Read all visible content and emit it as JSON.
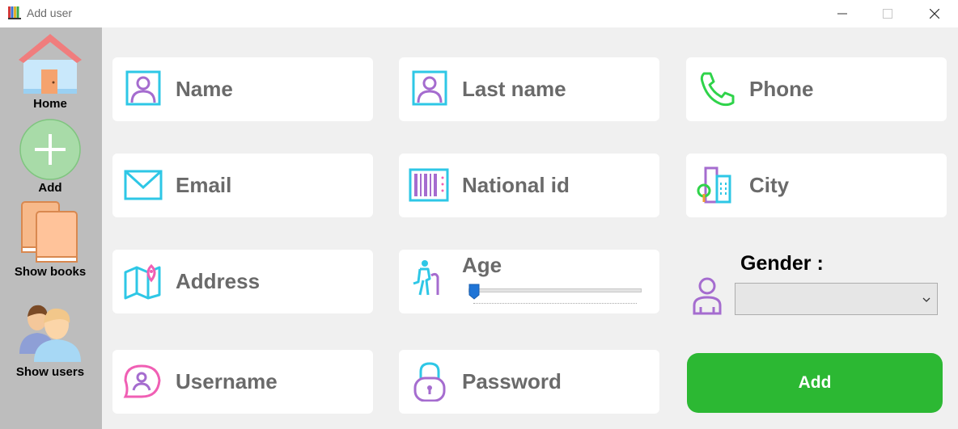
{
  "window": {
    "title": "Add user"
  },
  "sidebar": {
    "items": [
      {
        "label": "Home",
        "icon": "home-icon"
      },
      {
        "label": "Add",
        "icon": "plus-icon"
      },
      {
        "label": "Show books",
        "icon": "books-icon"
      },
      {
        "label": "Show users",
        "icon": "users-icon"
      }
    ]
  },
  "form": {
    "fields": [
      {
        "label": "Name",
        "icon": "person-card-icon"
      },
      {
        "label": "Last name",
        "icon": "person-card-icon"
      },
      {
        "label": "Phone",
        "icon": "phone-icon"
      },
      {
        "label": "Email",
        "icon": "envelope-icon"
      },
      {
        "label": "National id",
        "icon": "id-barcode-icon"
      },
      {
        "label": "City",
        "icon": "city-icon"
      },
      {
        "label": "Address",
        "icon": "map-pin-icon"
      },
      {
        "label": "Username",
        "icon": "user-pin-icon"
      },
      {
        "label": "Password",
        "icon": "lock-icon"
      }
    ],
    "age": {
      "label": "Age",
      "value": 0
    },
    "gender": {
      "label": "Gender :",
      "value": ""
    },
    "submit_label": "Add"
  },
  "colors": {
    "accent_cyan": "#2ec7e6",
    "accent_purple": "#a56ccf",
    "accent_green": "#2fd34a",
    "accent_pink": "#f05fb4",
    "add_button": "#2cb833",
    "sidebar": "#bdbdbd",
    "label_gray": "#6a6a6a"
  }
}
